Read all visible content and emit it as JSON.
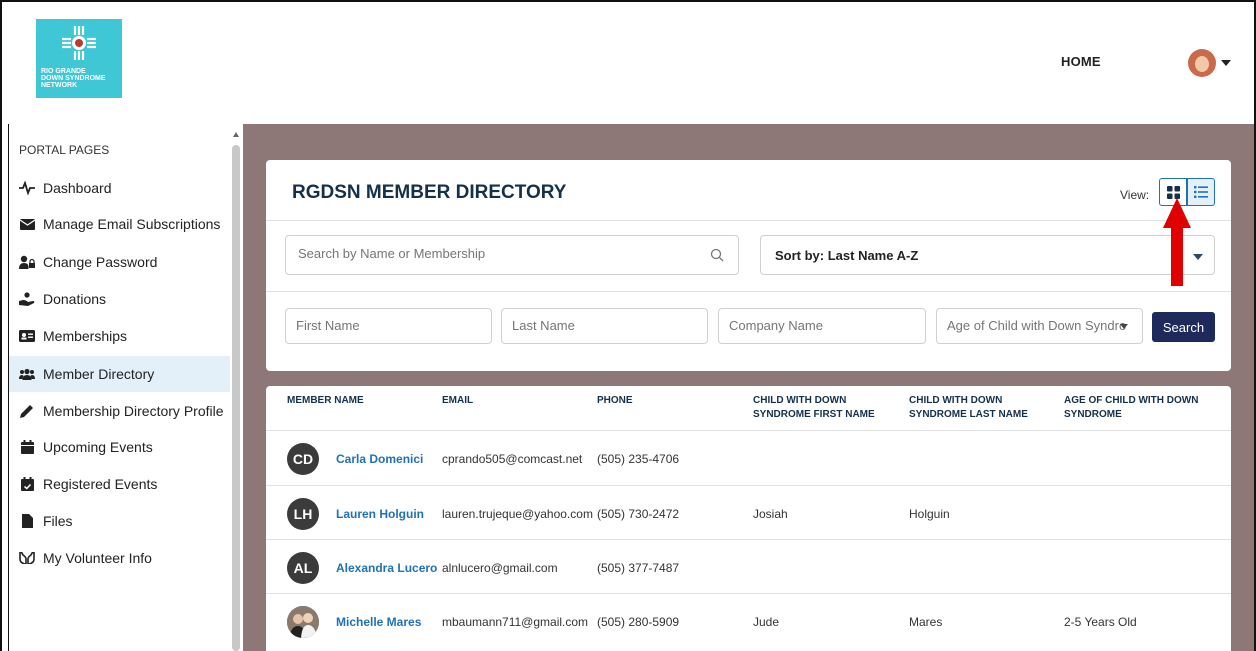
{
  "header": {
    "logo_text": [
      "RIO GRANDE",
      "DOWN SYNDROME",
      "NETWORK"
    ],
    "home_label": "HOME"
  },
  "sidebar": {
    "title": "PORTAL PAGES",
    "items": [
      {
        "label": "Dashboard",
        "icon": "pulse-icon"
      },
      {
        "label": "Manage Email Subscriptions",
        "icon": "envelope-icon"
      },
      {
        "label": "Change Password",
        "icon": "user-lock-icon"
      },
      {
        "label": "Donations",
        "icon": "hand-holding-icon"
      },
      {
        "label": "Memberships",
        "icon": "id-card-icon"
      },
      {
        "label": "Member Directory",
        "icon": "users-icon",
        "active": true
      },
      {
        "label": "Membership Directory Profile",
        "icon": "pencil-icon"
      },
      {
        "label": "Upcoming Events",
        "icon": "calendar-icon"
      },
      {
        "label": "Registered Events",
        "icon": "calendar-check-icon"
      },
      {
        "label": "Files",
        "icon": "file-icon"
      },
      {
        "label": "My Volunteer Info",
        "icon": "hands-icon"
      }
    ]
  },
  "directory": {
    "title": "RGDSN MEMBER DIRECTORY",
    "view_label": "View:",
    "search_placeholder": "Search by Name or Membership",
    "sort_label": "Sort by: Last Name A-Z",
    "filters": {
      "first_name": "First Name",
      "last_name": "Last Name",
      "company_name": "Company Name",
      "age_of_child": "Age of Child with Down Syndrome"
    },
    "search_button": "Search",
    "columns": [
      "MEMBER NAME",
      "EMAIL",
      "PHONE",
      "CHILD WITH DOWN SYNDROME FIRST NAME",
      "CHILD WITH DOWN SYNDROME LAST NAME",
      "AGE OF CHILD WITH DOWN SYNDROME"
    ],
    "rows": [
      {
        "initials": "CD",
        "name": "Carla Domenici",
        "email": "cprando505@comcast.net",
        "phone": "(505) 235-4706",
        "child_first": "",
        "child_last": "",
        "child_age": ""
      },
      {
        "initials": "LH",
        "name": "Lauren Holguin",
        "email": "lauren.trujeque@yahoo.com",
        "phone": "(505) 730-2472",
        "child_first": "Josiah",
        "child_last": "Holguin",
        "child_age": ""
      },
      {
        "initials": "AL",
        "name": "Alexandra Lucero",
        "email": "alnlucero@gmail.com",
        "phone": "(505) 377-7487",
        "child_first": "",
        "child_last": "",
        "child_age": ""
      },
      {
        "initials": "",
        "name": "Michelle Mares",
        "email": "mbaumann711@gmail.com",
        "phone": "(505) 280-5909",
        "child_first": "Jude",
        "child_last": "Mares",
        "child_age": "2-5 Years Old"
      }
    ]
  },
  "colors": {
    "main_bg": "#8e7777",
    "brand_teal": "#3fc7d6",
    "link_blue": "#1f72b8",
    "button_navy": "#1f2a5c",
    "annotation_red": "#e00000"
  }
}
